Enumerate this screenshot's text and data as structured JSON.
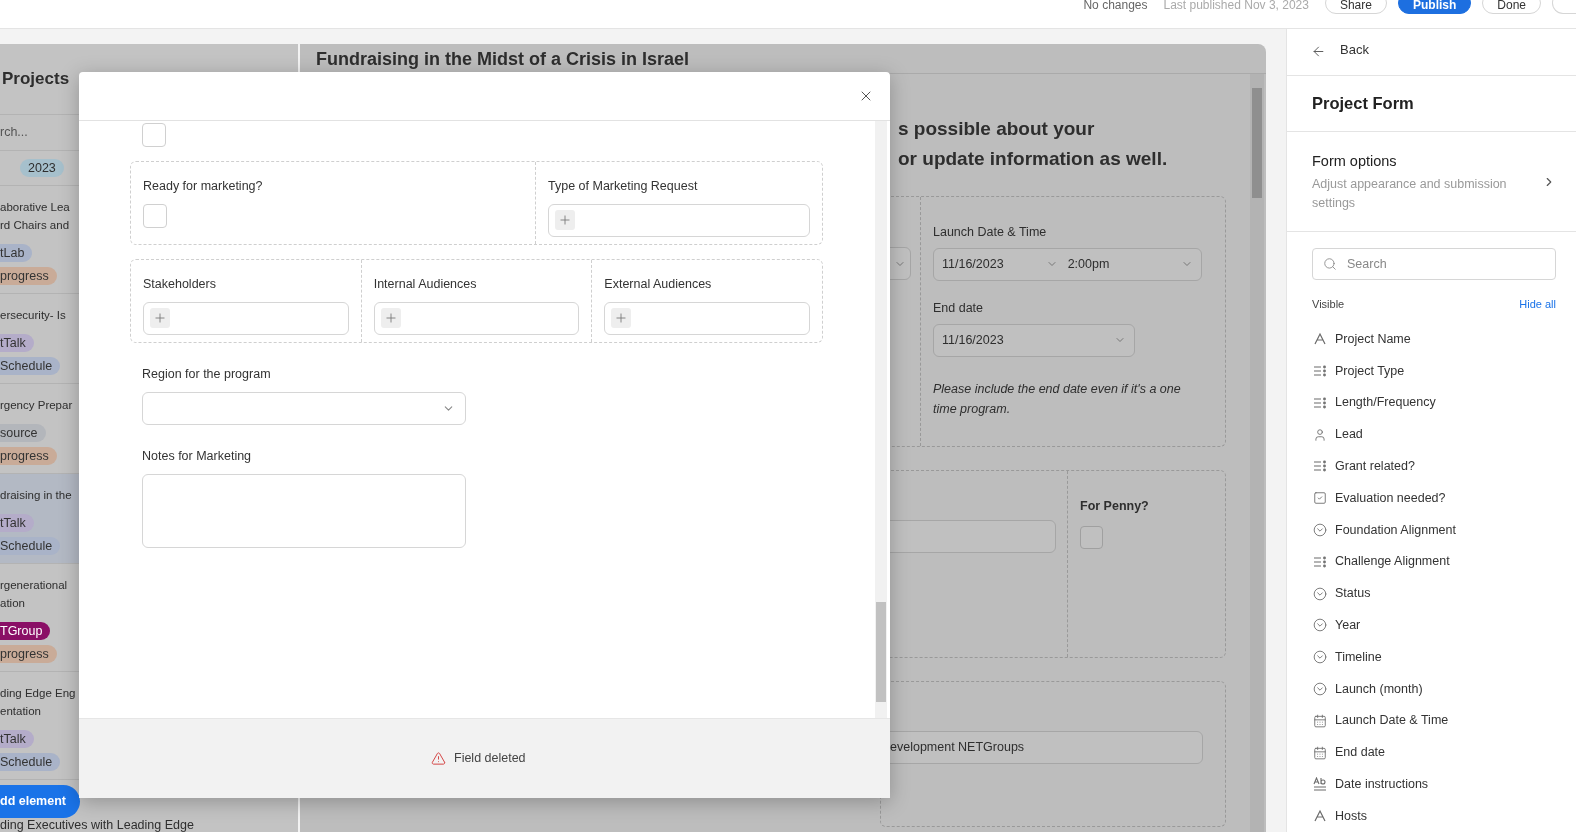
{
  "top_bar": {
    "status": "No changes",
    "published": "Last published Nov 3, 2023",
    "buttons": [
      {
        "label": "Share",
        "kind": "secondary"
      },
      {
        "label": "Publish",
        "kind": "primary"
      },
      {
        "label": "Done",
        "kind": "secondary"
      }
    ]
  },
  "sidebar": {
    "title": "Projects",
    "search_placeholder": "rch...",
    "year_tag": "2023",
    "items": [
      {
        "lines": [
          "aborative Lea",
          "rd Chairs and"
        ],
        "selected": false,
        "tags": [
          {
            "label": "tLab",
            "color": "#a9b3c8"
          },
          {
            "label": "progress",
            "color": "#c9ab98"
          }
        ]
      },
      {
        "lines": [
          "ersecurity- Is"
        ],
        "selected": false,
        "tags": [
          {
            "label": "tTalk",
            "color": "#b4acc9"
          },
          {
            "label": "Schedule",
            "color": "#a9b3c8"
          }
        ]
      },
      {
        "lines": [
          "rgency Prepar"
        ],
        "selected": false,
        "tags": [
          {
            "label": "source",
            "color": "#b3b6bb"
          },
          {
            "label": "progress",
            "color": "#c9ab98"
          }
        ]
      },
      {
        "lines": [
          "draising in the"
        ],
        "selected": true,
        "tags": [
          {
            "label": "tTalk",
            "color": "#b4acc9"
          },
          {
            "label": "Schedule",
            "color": "#a9b3c8"
          }
        ]
      },
      {
        "lines": [
          "rgenerational",
          "ation"
        ],
        "selected": false,
        "tags": [
          {
            "label": "TGroup",
            "color": "#8a0f66"
          },
          {
            "label": "progress",
            "color": "#c9ab98"
          }
        ]
      },
      {
        "lines": [
          "ding Edge Eng",
          "entation"
        ],
        "selected": false,
        "tags": [
          {
            "label": "tTalk",
            "color": "#b4acc9"
          },
          {
            "label": "Schedule",
            "color": "#a9b3c8"
          }
        ]
      }
    ],
    "add_button": "dd element",
    "last_item": "ding Executives with Leading Edge"
  },
  "canvas": {
    "title": "Fundraising in the Midst of a Crisis in Israel",
    "heading_lines": [
      "s possible about your",
      "or update information as well."
    ],
    "launch": {
      "label": "Launch Date & Time",
      "date": "11/16/2023",
      "time": "2:00pm"
    },
    "end": {
      "label": "End date",
      "date": "11/16/2023"
    },
    "note": "Please include the end date even if it's a one time program.",
    "penny": {
      "label": "For Penny?",
      "checked": false
    },
    "groups_value": "evelopment NETGroups"
  },
  "modal": {
    "sections": [
      {
        "grouped": false,
        "fields": [
          {
            "kind": "checkbox",
            "checked": false
          }
        ]
      },
      {
        "grouped": true,
        "fields": [
          {
            "kind": "checkbox",
            "label": "Ready for marketing?",
            "checked": false
          },
          {
            "kind": "multi",
            "label": "Type of Marketing Request"
          }
        ]
      },
      {
        "grouped": true,
        "fields": [
          {
            "kind": "multi",
            "label": "Stakeholders"
          },
          {
            "kind": "multi",
            "label": "Internal Audiences"
          },
          {
            "kind": "multi",
            "label": "External Audiences"
          }
        ]
      },
      {
        "grouped": false,
        "fields": [
          {
            "kind": "select",
            "label": "Region for the program"
          }
        ]
      },
      {
        "grouped": false,
        "fields": [
          {
            "kind": "textarea",
            "label": "Notes for Marketing"
          }
        ]
      }
    ],
    "toast": "Field deleted"
  },
  "panel": {
    "back": "Back",
    "title": "Project Form",
    "options_title": "Form options",
    "options_desc": "Adjust appearance and submission settings",
    "search_placeholder": "Search",
    "visible_label": "Visible",
    "hide_all": "Hide all",
    "fields": [
      {
        "label": "Project Name",
        "kind": "text"
      },
      {
        "label": "Project Type",
        "kind": "multi"
      },
      {
        "label": "Length/Frequency",
        "kind": "multi"
      },
      {
        "label": "Lead",
        "kind": "person"
      },
      {
        "label": "Grant related?",
        "kind": "multi"
      },
      {
        "label": "Evaluation needed?",
        "kind": "checkbox"
      },
      {
        "label": "Foundation Alignment",
        "kind": "select"
      },
      {
        "label": "Challenge Alignment",
        "kind": "multi"
      },
      {
        "label": "Status",
        "kind": "select"
      },
      {
        "label": "Year",
        "kind": "select"
      },
      {
        "label": "Timeline",
        "kind": "select"
      },
      {
        "label": "Launch (month)",
        "kind": "select"
      },
      {
        "label": "Launch Date & Time",
        "kind": "date"
      },
      {
        "label": "End date",
        "kind": "date"
      },
      {
        "label": "Date instructions",
        "kind": "richtext"
      },
      {
        "label": "Hosts",
        "kind": "text"
      }
    ]
  }
}
